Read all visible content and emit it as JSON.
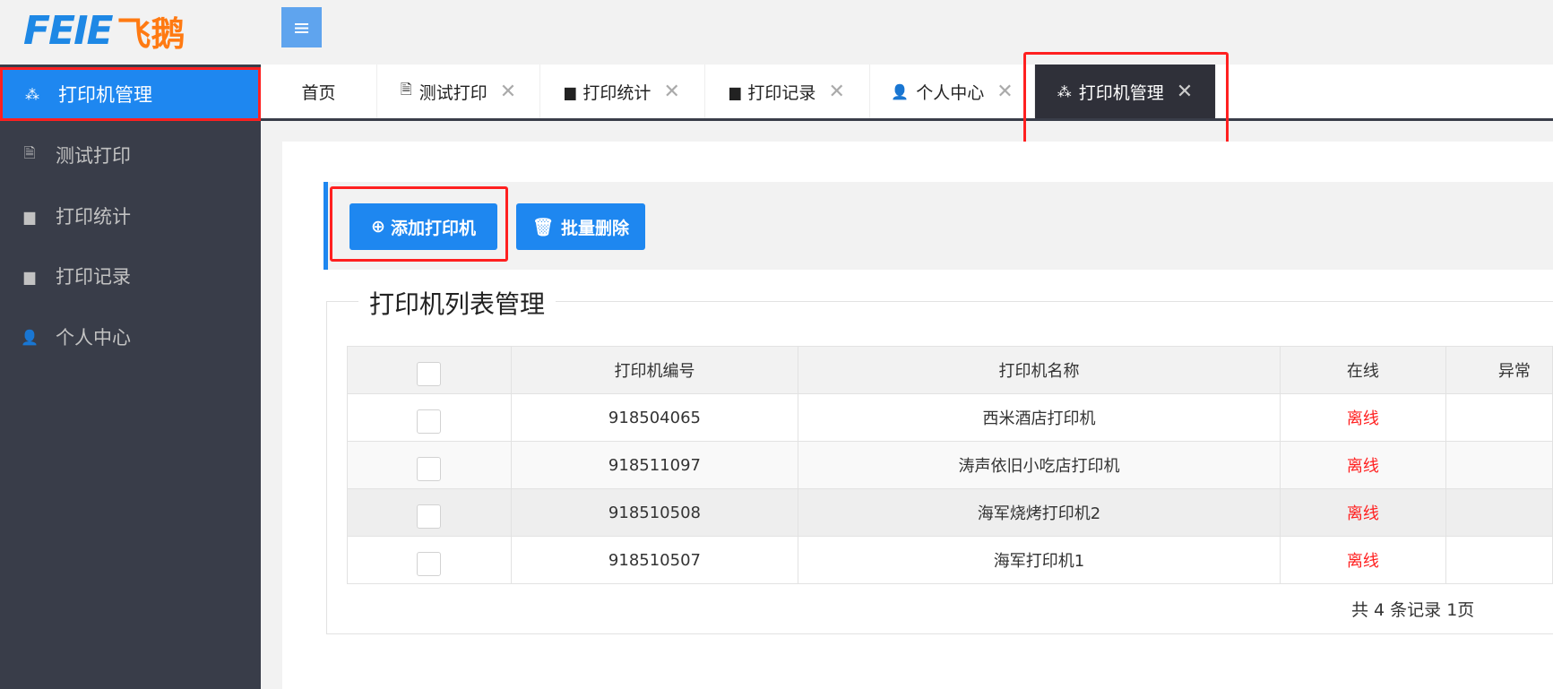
{
  "logo": {
    "en": "FEIE",
    "cn": "飞鹅"
  },
  "menu_icon": "hamburger-icon",
  "sidebar": {
    "items": [
      {
        "label": "打印机管理",
        "icon": "cubes-icon",
        "active": true
      },
      {
        "label": "测试打印",
        "icon": "document-icon"
      },
      {
        "label": "打印统计",
        "icon": "presentation-icon"
      },
      {
        "label": "打印记录",
        "icon": "presentation-icon"
      },
      {
        "label": "个人中心",
        "icon": "user-icon"
      }
    ]
  },
  "tabs": [
    {
      "label": "首页"
    },
    {
      "label": "测试打印",
      "icon": "document-icon"
    },
    {
      "label": "打印统计",
      "icon": "presentation-icon"
    },
    {
      "label": "打印记录",
      "icon": "presentation-icon"
    },
    {
      "label": "个人中心",
      "icon": "user-icon"
    },
    {
      "label": "打印机管理",
      "icon": "cubes-icon",
      "active": true
    }
  ],
  "toolbar": {
    "add_label": "添加打印机",
    "delete_label": "批量删除"
  },
  "list": {
    "title": "打印机列表管理",
    "columns": [
      "",
      "打印机编号",
      "打印机名称",
      "在线",
      "异常"
    ],
    "rows": [
      {
        "sn": "918504065",
        "name": "西米酒店打印机",
        "status": "离线"
      },
      {
        "sn": "918511097",
        "name": "涛声依旧小吃店打印机",
        "status": "离线"
      },
      {
        "sn": "918510508",
        "name": "海军烧烤打印机2",
        "status": "离线"
      },
      {
        "sn": "918510507",
        "name": "海军打印机1",
        "status": "离线"
      }
    ],
    "footer": "共 4 条记录 1页"
  },
  "colors": {
    "accent": "#1e87f0",
    "sidebar": "#393d49",
    "offline": "#ff2020",
    "highlight": "#ff2020"
  }
}
